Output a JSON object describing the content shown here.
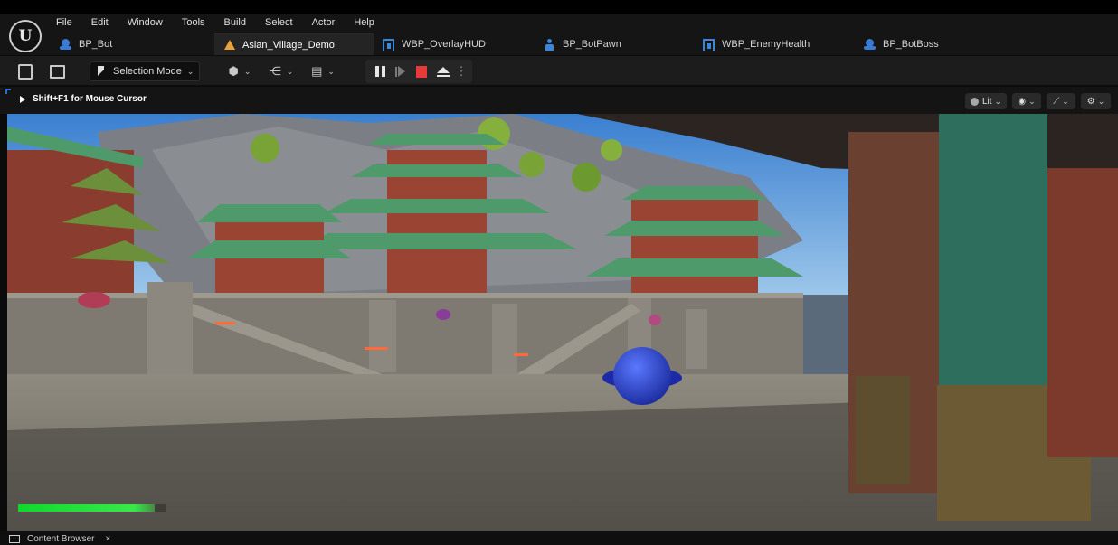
{
  "menu": [
    "File",
    "Edit",
    "Window",
    "Tools",
    "Build",
    "Select",
    "Actor",
    "Help"
  ],
  "tabs": [
    {
      "label": "BP_Bot",
      "icon": "blueprint-icon",
      "active": false
    },
    {
      "label": "Asian_Village_Demo",
      "icon": "level-icon",
      "active": true
    },
    {
      "label": "WBP_OverlayHUD",
      "icon": "widget-blueprint-icon",
      "active": false
    },
    {
      "label": "BP_BotPawn",
      "icon": "pawn-icon",
      "active": false
    },
    {
      "label": "WBP_EnemyHealth",
      "icon": "widget-blueprint-icon",
      "active": false
    },
    {
      "label": "BP_BotBoss",
      "icon": "blueprint-icon",
      "active": false
    }
  ],
  "toolbar": {
    "selection_mode": "Selection Mode"
  },
  "viewport": {
    "hint": "Shift+F1 for Mouse Cursor",
    "view_mode": "Lit"
  },
  "hud": {
    "health_fraction": 0.92,
    "health_color": "#1ee23a"
  },
  "bottom": {
    "content_browser": "Content Browser",
    "close": "×"
  },
  "colors": {
    "accent_blue": "#2b6fd6",
    "stop_red": "#e83a3a",
    "level_orange": "#e8a23a"
  }
}
